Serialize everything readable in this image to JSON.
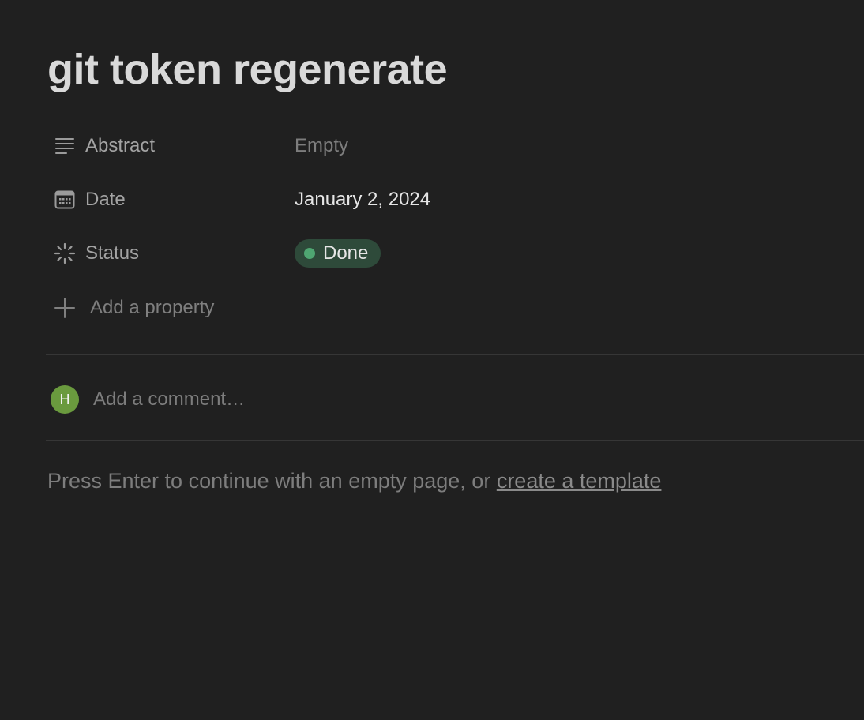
{
  "page": {
    "title": "git token regenerate"
  },
  "properties": [
    {
      "name": "Abstract",
      "icon": "text-lines-icon",
      "value": "Empty",
      "is_empty": true
    },
    {
      "name": "Date",
      "icon": "calendar-icon",
      "value": "January 2, 2024",
      "is_empty": false
    },
    {
      "name": "Status",
      "icon": "status-spinner-icon",
      "value": "Done",
      "is_empty": false
    }
  ],
  "status_colors": {
    "done_background": "#2e4a3a",
    "done_dot": "#4fa672"
  },
  "add_property": {
    "label": "Add a property",
    "icon": "plus-icon"
  },
  "comment": {
    "avatar_initial": "H",
    "avatar_color": "#6a9a3e",
    "placeholder": "Add a comment…"
  },
  "hint": {
    "text": "Press Enter to continue with an empty page, or ",
    "link_label": "create a template"
  }
}
